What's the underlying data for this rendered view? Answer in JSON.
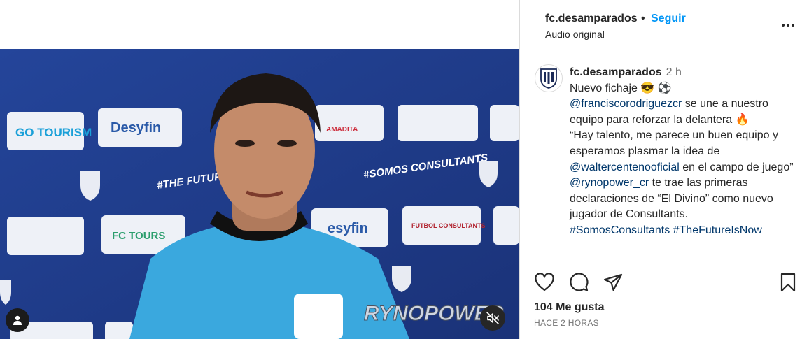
{
  "header": {
    "username": "fc.desamparados",
    "separator": "•",
    "follow_label": "Seguir",
    "audio_label": "Audio original",
    "more_icon": "more-horizontal-icon"
  },
  "caption": {
    "username": "fc.desamparados",
    "time": "2 h",
    "line1_text": "Nuevo fichaje ",
    "line1_emoji": "😎 ⚽",
    "mention1": "@franciscorodriguezcr",
    "text2": " se une a nuestro equipo para reforzar la delantera ",
    "fire_emoji": "🔥",
    "quote": "“Hay talento, me parece un buen equipo y esperamos plasmar la idea de ",
    "mention2": "@waltercentenooficial",
    "quote_end": " en el campo de juego”",
    "mention3": "@rynopower_cr",
    "text3": " te trae las primeras declaraciones de “El Divino” como nuevo jugador de Consultants.",
    "hashtags": "#SomosConsultants #TheFutureIsNow"
  },
  "actions": {
    "likes": "104 Me gusta",
    "time_ago": "HACE 2 HORAS"
  },
  "video": {
    "sponsors": [
      "GO TOURISM",
      "Desyfin",
      "AMADITA",
      "FC TOURS",
      "esyfin",
      "FUTBOL CONSULTANTS",
      "#SOMOS CONSULTANTS",
      "#THE FUTURE IS NOW!"
    ],
    "watermark": "RYNOPOWER"
  },
  "colors": {
    "link": "#00376b",
    "follow": "#0095f6",
    "banner": "#1f3c86",
    "jersey": "#3aa8de"
  }
}
